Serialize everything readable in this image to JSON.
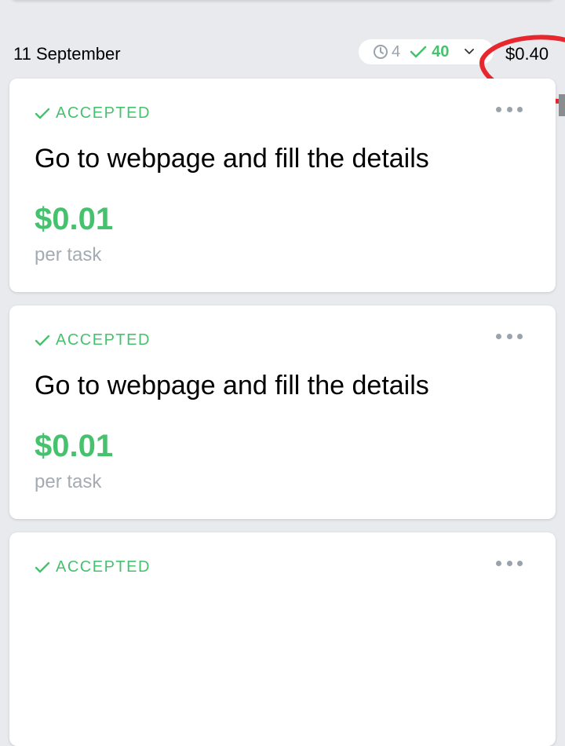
{
  "day": {
    "date": "11 September",
    "pending_count": "4",
    "accepted_count": "40",
    "total": "$0.40"
  },
  "tasks": [
    {
      "status": "ACCEPTED",
      "title": "Go to webpage and fill the details",
      "price": "$0.01",
      "price_unit": "per task"
    },
    {
      "status": "ACCEPTED",
      "title": "Go to webpage and fill the details",
      "price": "$0.01",
      "price_unit": "per task"
    },
    {
      "status": "ACCEPTED",
      "title": "",
      "price": "",
      "price_unit": ""
    }
  ],
  "icons": {
    "pending": "clock-icon",
    "accepted": "check-icon",
    "expand": "chevron-down-icon",
    "menu": "more-horizontal-icon"
  },
  "colors": {
    "accent_green": "#46c26e",
    "muted_gray": "#9aa3ad",
    "background": "#e8eaed",
    "annotation_red": "#e8262e"
  }
}
